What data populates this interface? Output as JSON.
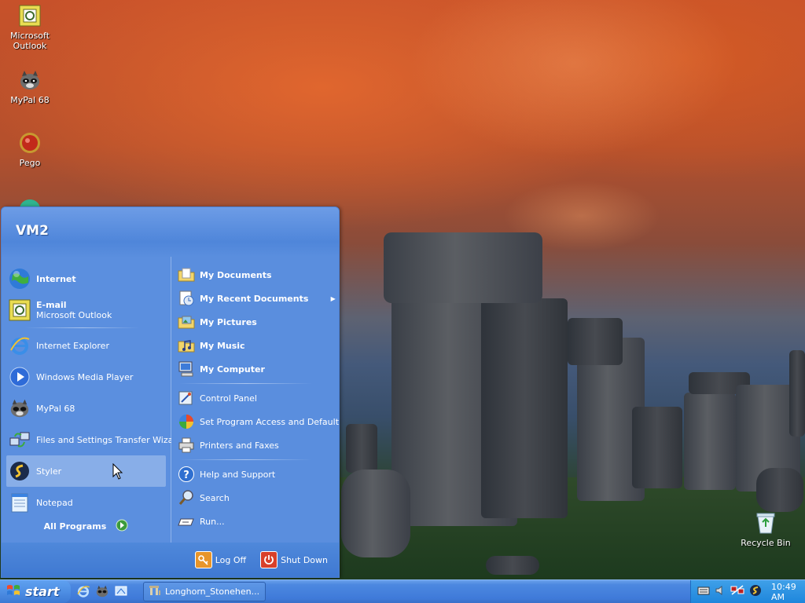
{
  "desktop": {
    "icons": [
      {
        "label": "Microsoft Outlook",
        "icon": "outlook-icon"
      },
      {
        "label": "MyPal 68",
        "icon": "raccoon-icon"
      },
      {
        "label": "Pego",
        "icon": "pego-icon"
      },
      {
        "label": "Recycle Bin",
        "icon": "recycle-bin-icon"
      }
    ]
  },
  "start_menu": {
    "user": "VM2",
    "left": {
      "internet_label": "Internet",
      "email_label": "E-mail",
      "email_sub": "Microsoft Outlook",
      "recent": [
        "Internet Explorer",
        "Windows Media Player",
        "MyPal 68",
        "Files and Settings Transfer Wizard",
        "Styler",
        "Notepad"
      ],
      "all_programs": "All Programs"
    },
    "right": {
      "bold_items": [
        "My Documents",
        "My Recent Documents",
        "My Pictures",
        "My Music",
        "My Computer"
      ],
      "system_items": [
        "Control Panel",
        "Set Program Access and Defaults",
        "Printers and Faxes"
      ],
      "help_items": [
        "Help and Support",
        "Search",
        "Run..."
      ]
    },
    "footer": {
      "log_off": "Log Off",
      "shut_down": "Shut Down"
    }
  },
  "taskbar": {
    "start_label": "start",
    "task": "Longhorn_Stonehen...",
    "clock": "10:49 AM"
  },
  "colors": {
    "start_green": "#3c9b3c",
    "taskbar_blue": "#3f7ad9",
    "menu_blue": "#5b8fdf"
  }
}
